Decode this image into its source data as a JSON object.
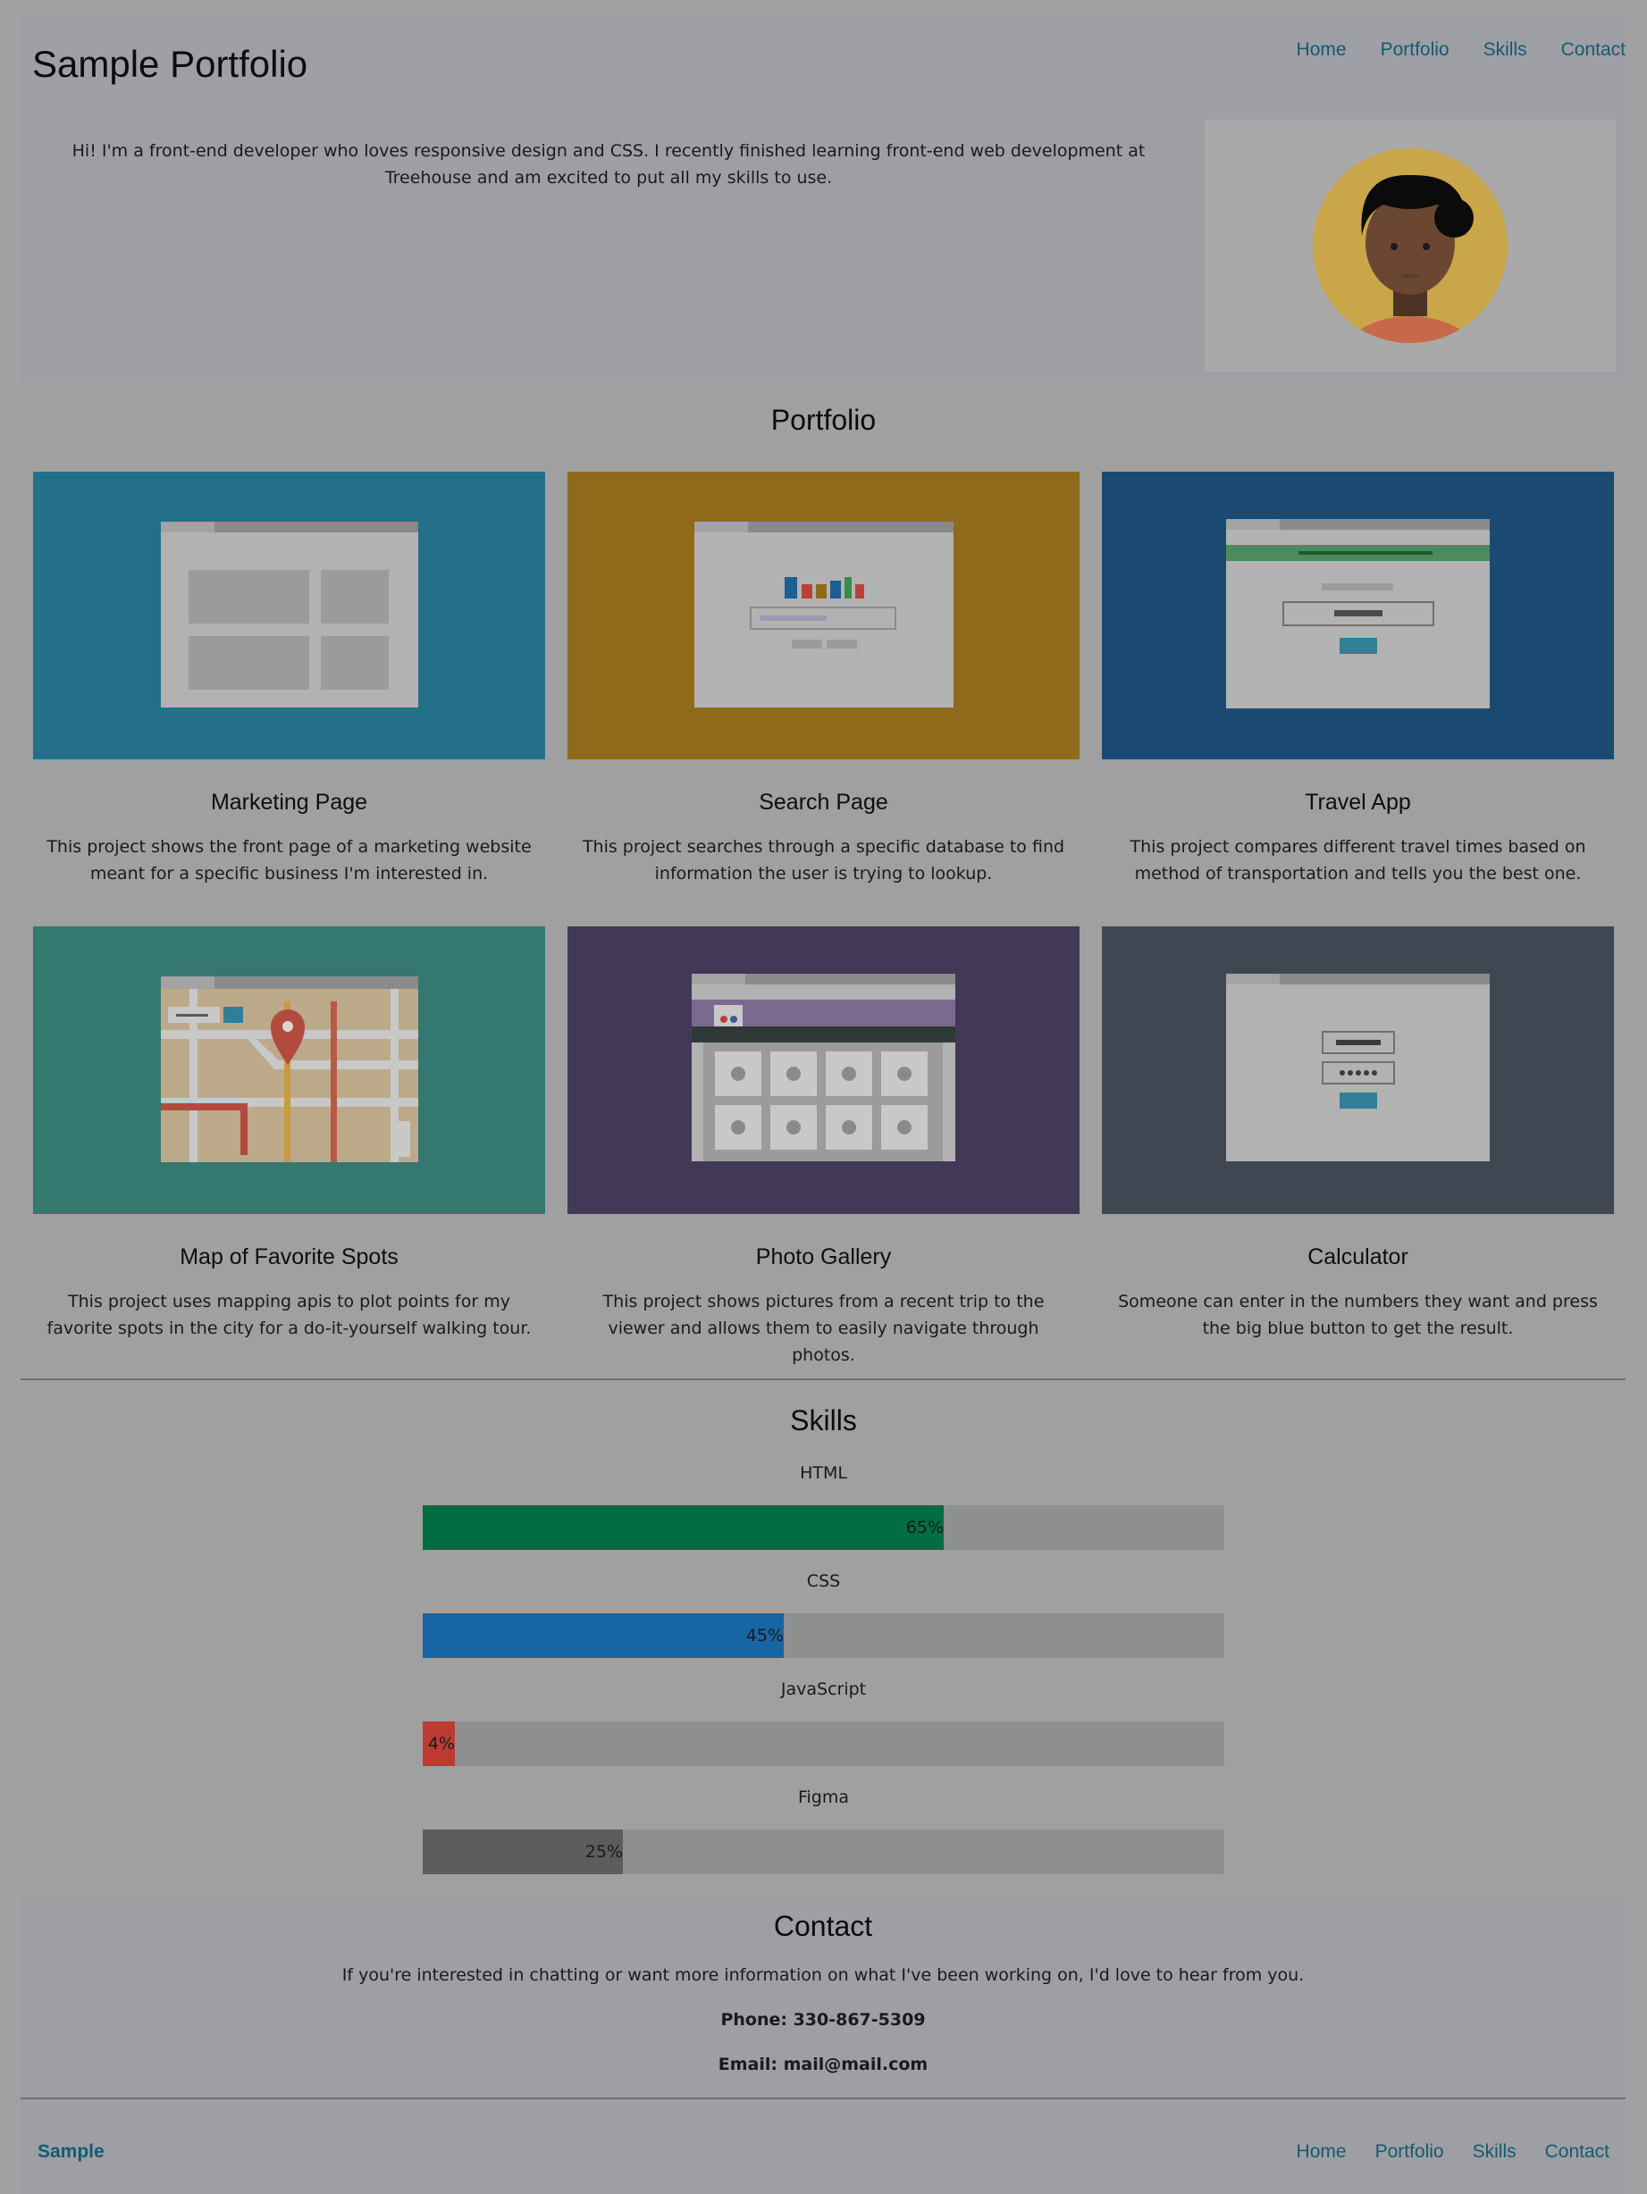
{
  "header": {
    "title": "Sample Portfolio",
    "nav": [
      "Home",
      "Portfolio",
      "Skills",
      "Contact"
    ],
    "intro": "Hi! I'm a front-end developer who loves responsive design and CSS. I recently finished learning front-end web development at Treehouse and am excited to put all my skills to use."
  },
  "portfolio": {
    "title": "Portfolio",
    "projects": [
      {
        "title": "Marketing Page",
        "description": "This project shows the front page of a marketing website meant for a specific business I'm interested in.",
        "color": "#22708a"
      },
      {
        "title": "Search Page",
        "description": "This project searches through a specific database to find information the user is trying to lookup.",
        "color": "#8e6a1a"
      },
      {
        "title": "Travel App",
        "description": "This project compares different travel times based on method of transportation and tells you the best one.",
        "color": "#1a4a72"
      },
      {
        "title": "Map of Favorite Spots",
        "description": "This project uses mapping apis to plot points for my favorite spots in the city for a do-it-yourself walking tour.",
        "color": "#357870"
      },
      {
        "title": "Photo Gallery",
        "description": "This project shows pictures from a recent trip to the viewer and allows them to easily navigate through photos.",
        "color": "#433858"
      },
      {
        "title": "Calculator",
        "description": "Someone can enter in the numbers they want and press the big blue button to get the result.",
        "color": "#3f4852"
      }
    ]
  },
  "skills": {
    "title": "Skills",
    "items": [
      {
        "name": "HTML",
        "percent": 65,
        "label": "65%",
        "color": "#026d43"
      },
      {
        "name": "CSS",
        "percent": 45,
        "label": "45%",
        "color": "#1865a4"
      },
      {
        "name": "JavaScript",
        "percent": 4,
        "label": "4%",
        "color": "#be3b33"
      },
      {
        "name": "Figma",
        "percent": 25,
        "label": "25%",
        "color": "#5d5d5d"
      }
    ]
  },
  "contact": {
    "title": "Contact",
    "text": "If you're interested in chatting or want more information on what I've been working on, I'd love to hear from you.",
    "phone": "Phone: 330-867-5309",
    "email": "Email: mail@mail.com"
  },
  "footer": {
    "brand": "Sample",
    "nav": [
      "Home",
      "Portfolio",
      "Skills",
      "Contact"
    ]
  },
  "colors": {
    "link": "#155a73"
  }
}
